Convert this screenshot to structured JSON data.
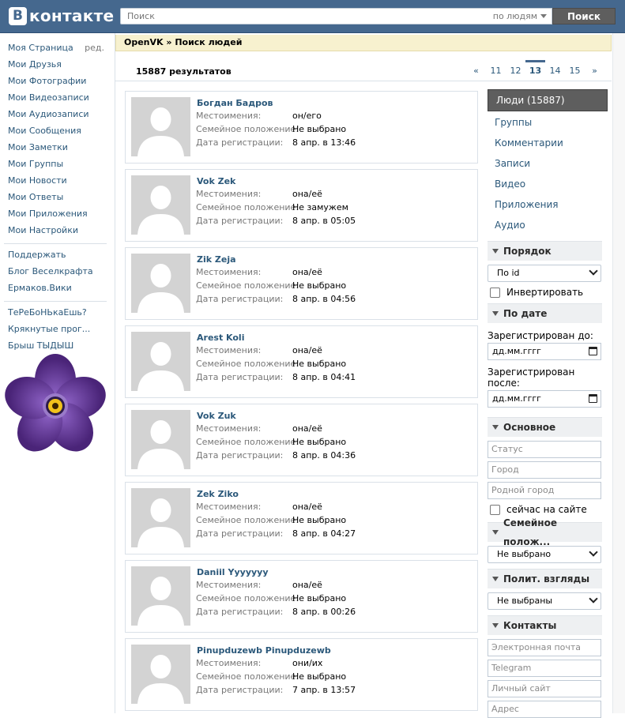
{
  "header": {
    "logo_letter": "В",
    "logo_text": "контакте",
    "search_placeholder": "Поиск",
    "search_scope": "по людям",
    "search_button": "Поиск"
  },
  "nav": {
    "edit_label": "ред.",
    "items": [
      "Моя Страница",
      "Мои Друзья",
      "Мои Фотографии",
      "Мои Видеозаписи",
      "Мои Аудиозаписи",
      "Мои Сообщения",
      "Мои Заметки",
      "Мои Группы",
      "Мои Новости",
      "Мои Ответы",
      "Мои Приложения",
      "Мои Настройки"
    ],
    "links": [
      "Поддержать",
      "Блог Веселкрафта",
      "Ермаков.Вики"
    ],
    "extra": [
      "ТеРеБоНЬкаЕшь?",
      "Крякнутые прог...",
      "Брыш ТЫДЫШ"
    ]
  },
  "breadcrumb": "OpenVK » Поиск людей",
  "results_count": "15887 результатов",
  "pager": [
    "«",
    "11",
    "12",
    "13",
    "14",
    "15",
    "»"
  ],
  "pager_active": "13",
  "labels": {
    "pronouns": "Местоимения:",
    "status": "Семейное положение:",
    "registered": "Дата регистрации:"
  },
  "results": [
    {
      "name": "Богдан Бадров",
      "pronouns": "он/его",
      "status": "Не выбрано",
      "registered": "8 апр. в 13:46"
    },
    {
      "name": "Vok Zek",
      "pronouns": "она/её",
      "status": "Не замужем",
      "registered": "8 апр. в 05:05"
    },
    {
      "name": "Zik Zeja",
      "pronouns": "она/её",
      "status": "Не выбрано",
      "registered": "8 апр. в 04:56"
    },
    {
      "name": "Arest Koli",
      "pronouns": "она/её",
      "status": "Не выбрано",
      "registered": "8 апр. в 04:41"
    },
    {
      "name": "Vok Zuk",
      "pronouns": "она/её",
      "status": "Не выбрано",
      "registered": "8 апр. в 04:36"
    },
    {
      "name": "Zek Ziko",
      "pronouns": "она/её",
      "status": "Не выбрано",
      "registered": "8 апр. в 04:27"
    },
    {
      "name": "Daniil Yyyyyyy",
      "pronouns": "она/её",
      "status": "Не выбрано",
      "registered": "8 апр. в 00:26"
    },
    {
      "name": "Pinupduzewb Pinupduzewb",
      "pronouns": "они/их",
      "status": "Не выбрано",
      "registered": "7 апр. в 13:57"
    }
  ],
  "filters": {
    "tabs": [
      "Люди (15887)",
      "Группы",
      "Комментарии",
      "Записи",
      "Видео",
      "Приложения",
      "Аудио"
    ],
    "order": {
      "title": "Порядок",
      "value": "По id",
      "invert": "Инвертировать"
    },
    "date": {
      "title": "По дате",
      "before": "Зарегистрирован до:",
      "after": "Зарегистрирован после:",
      "placeholder": "дд.мм.гггг"
    },
    "basic": {
      "title": "Основное",
      "status": "Статус",
      "city": "Город",
      "hometown": "Родной город",
      "online": "сейчас на сайте"
    },
    "marital": {
      "title": "Семейное полож...",
      "value": "Не выбрано"
    },
    "politics": {
      "title": "Полит. взгляды",
      "value": "Не выбраны"
    },
    "contacts": {
      "title": "Контакты",
      "email": "Электронная почта",
      "telegram": "Telegram",
      "site": "Личный сайт",
      "address": "Адрес"
    }
  },
  "colors": {
    "header": "#45688e",
    "link": "#2b587a",
    "breadcrumb_bg": "#f7f1cf",
    "active_tab": "#5e5e5e"
  }
}
